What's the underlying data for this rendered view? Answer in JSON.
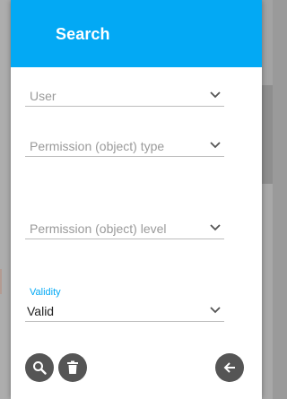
{
  "panel": {
    "title": "Search"
  },
  "fields": {
    "user": {
      "placeholder": "User",
      "value": ""
    },
    "permission_type": {
      "placeholder": "Permission (object) type",
      "value": ""
    },
    "permission_level": {
      "placeholder": "Permission (object) level",
      "value": ""
    },
    "validity": {
      "label": "Validity",
      "value": "Valid"
    }
  },
  "actions": {
    "search": {
      "icon": "search-icon"
    },
    "clear": {
      "icon": "trash-icon"
    },
    "back": {
      "icon": "arrow-left-icon"
    }
  },
  "colors": {
    "header": "#03a9f4",
    "accent_label": "#03a9f4",
    "fab": "#555555",
    "placeholder": "#9a9a9a"
  }
}
